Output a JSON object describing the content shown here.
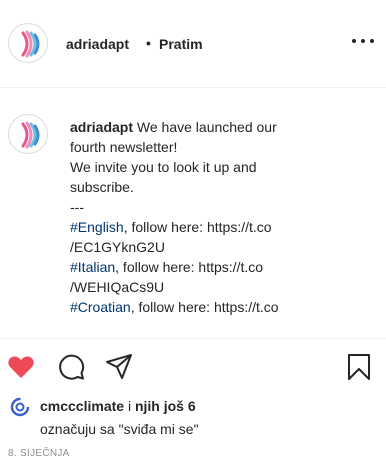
{
  "header": {
    "username": "adriadapt",
    "separator": "•",
    "follow_label": "Pratim"
  },
  "caption": {
    "username": "adriadapt",
    "lines": [
      "We have launched our",
      "fourth newsletter!",
      "We invite you to look it up and",
      "subscribe.",
      "---"
    ],
    "links": [
      {
        "hashtag": "#English",
        "text": ", follow here: https://t.co",
        "cont": "/EC1GYknG2U"
      },
      {
        "hashtag": "#Italian",
        "text": ", follow here: https://t.co",
        "cont": "/WEHIQaCs9U"
      },
      {
        "hashtag": "#Croatian",
        "text": ", follow here: https://t.co",
        "cont": ""
      }
    ]
  },
  "actions": {
    "like_icon": "heart-filled-icon",
    "comment_icon": "comment-icon",
    "share_icon": "paper-plane-icon",
    "save_icon": "bookmark-icon"
  },
  "likes": {
    "user": "cmccclimate",
    "mid": " i ",
    "others": "njih još 6",
    "suffix": "označuju sa \"sviđa mi se\""
  },
  "date": "8. SIJEČNJA",
  "colors": {
    "like_red": "#ed4956",
    "hashtag_blue": "#00376b",
    "logo_blue": "#3f8fd2",
    "logo_pink": "#e9568f",
    "cmcc_blue": "#3b5ecf"
  }
}
